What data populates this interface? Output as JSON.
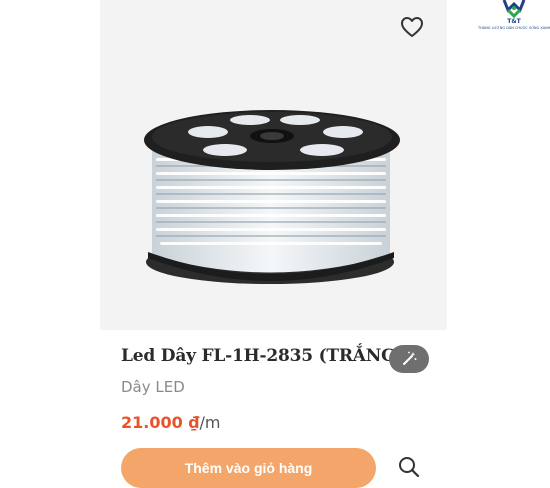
{
  "product": {
    "title": "Led Dây FL-1H-2835 (TRẮNG)",
    "category": "Dây LED",
    "price": "21.000",
    "currency": "₫",
    "per_unit": "/m",
    "add_to_cart_label": "Thêm vào giỏ hàng",
    "image_icon": "led-strip-reel"
  },
  "actions": {
    "favorite_icon": "heart-icon",
    "magic_icon": "magic-wand-icon",
    "quick_view_icon": "search-icon"
  },
  "logo": {
    "name": "T&T",
    "slogan": "THÀNG LƯỢNG DÂN CHUỘC SỐNG XANH"
  },
  "colors": {
    "accent_price": "#e8532a",
    "button_bg": "#f4a66a",
    "magic_bg": "#6f6f6f",
    "logo_blue": "#1f3f8a",
    "logo_green": "#2aa84a"
  }
}
